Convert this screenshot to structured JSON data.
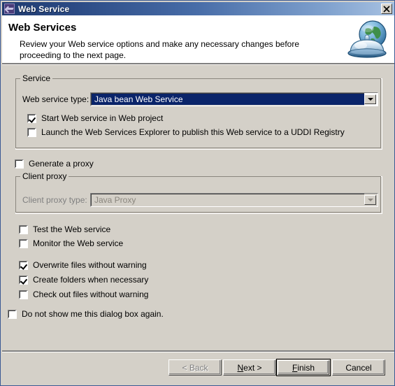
{
  "window": {
    "title": "Web Service",
    "icon": "web-service-icon",
    "close_label": "Close"
  },
  "header": {
    "title": "Web Services",
    "description": "Review your Web service options and make any necessary changes before proceeding to the next page.",
    "icon": "globe-service-bell-icon"
  },
  "service_group": {
    "legend": "Service",
    "web_service_type_label": "Web service type:",
    "web_service_type_value": "Java bean Web Service",
    "checkboxes": [
      {
        "label": "Start Web service in Web project",
        "checked": true
      },
      {
        "label": "Launch the Web Services Explorer to publish this Web service to a UDDI Registry",
        "checked": false
      }
    ]
  },
  "generate_proxy": {
    "label": "Generate a proxy",
    "checked": false
  },
  "client_proxy_group": {
    "legend": "Client proxy",
    "client_proxy_type_label": "Client proxy type:",
    "client_proxy_type_value": "Java Proxy",
    "disabled": true
  },
  "options": [
    {
      "label": "Test the Web service",
      "checked": false
    },
    {
      "label": "Monitor the Web service",
      "checked": false
    },
    {
      "label": "Overwrite files without warning",
      "checked": true
    },
    {
      "label": "Create folders when necessary",
      "checked": true
    },
    {
      "label": "Check out files without warning",
      "checked": false
    }
  ],
  "do_not_show": {
    "label": "Do not show me this dialog box again.",
    "checked": false
  },
  "buttons": {
    "back": {
      "label": "< Back",
      "disabled": true
    },
    "next": {
      "pre": "",
      "mnemonic": "N",
      "post": "ext >",
      "disabled": false
    },
    "finish": {
      "pre": "",
      "mnemonic": "F",
      "post": "inish",
      "default": true
    },
    "cancel": {
      "label": "Cancel",
      "disabled": false
    }
  },
  "colors": {
    "dialog_background": "#d4d0c8",
    "titlebar_start": "#1f3a6e",
    "titlebar_end": "#a8c2e2",
    "selection_blue": "#0a246a",
    "header_background": "#ffffff",
    "disabled_text": "#808080"
  }
}
